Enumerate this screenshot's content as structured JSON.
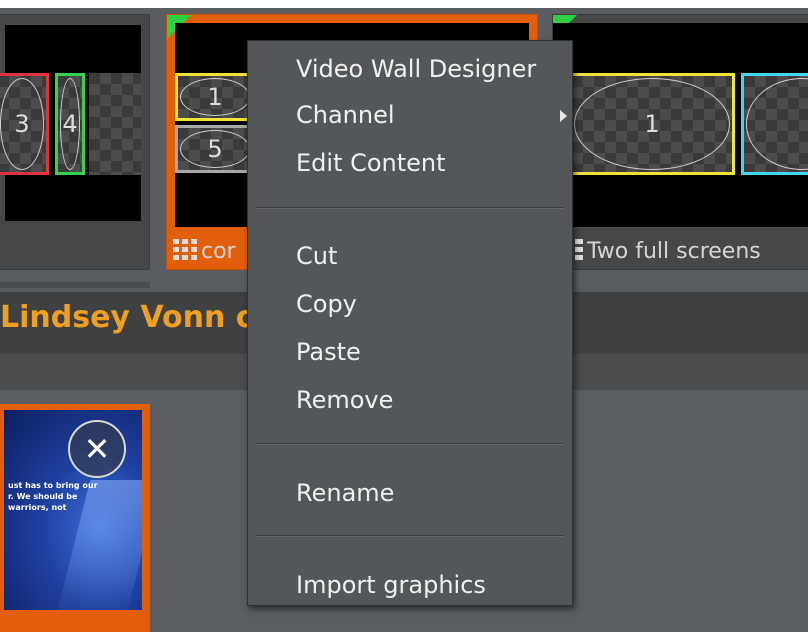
{
  "tiles": [
    {
      "id": "a",
      "cells": [
        "3",
        "4"
      ]
    },
    {
      "id": "b",
      "cells": [
        "1",
        "5"
      ],
      "label": "cor",
      "selected": true
    },
    {
      "id": "c",
      "cells": [
        "1"
      ],
      "label": "Two full screens"
    }
  ],
  "playlist": {
    "title": "Lindsey Vonn c"
  },
  "clip": {
    "thumb_text": "ust has to bring our r. We should be warriors, not"
  },
  "context_menu": {
    "items": [
      {
        "label": "Video Wall Designer"
      },
      {
        "label": "Channel",
        "has_submenu": true
      },
      {
        "label": "Edit Content"
      },
      {
        "label": "Cut"
      },
      {
        "label": "Copy"
      },
      {
        "label": "Paste"
      },
      {
        "label": "Remove"
      },
      {
        "label": "Rename"
      },
      {
        "label": "Import graphics"
      }
    ]
  },
  "colors": {
    "accent_orange": "#e35e0b",
    "title_orange": "#f0a020",
    "menu_bg": "#545759",
    "corner_green": "#2fcf43"
  }
}
